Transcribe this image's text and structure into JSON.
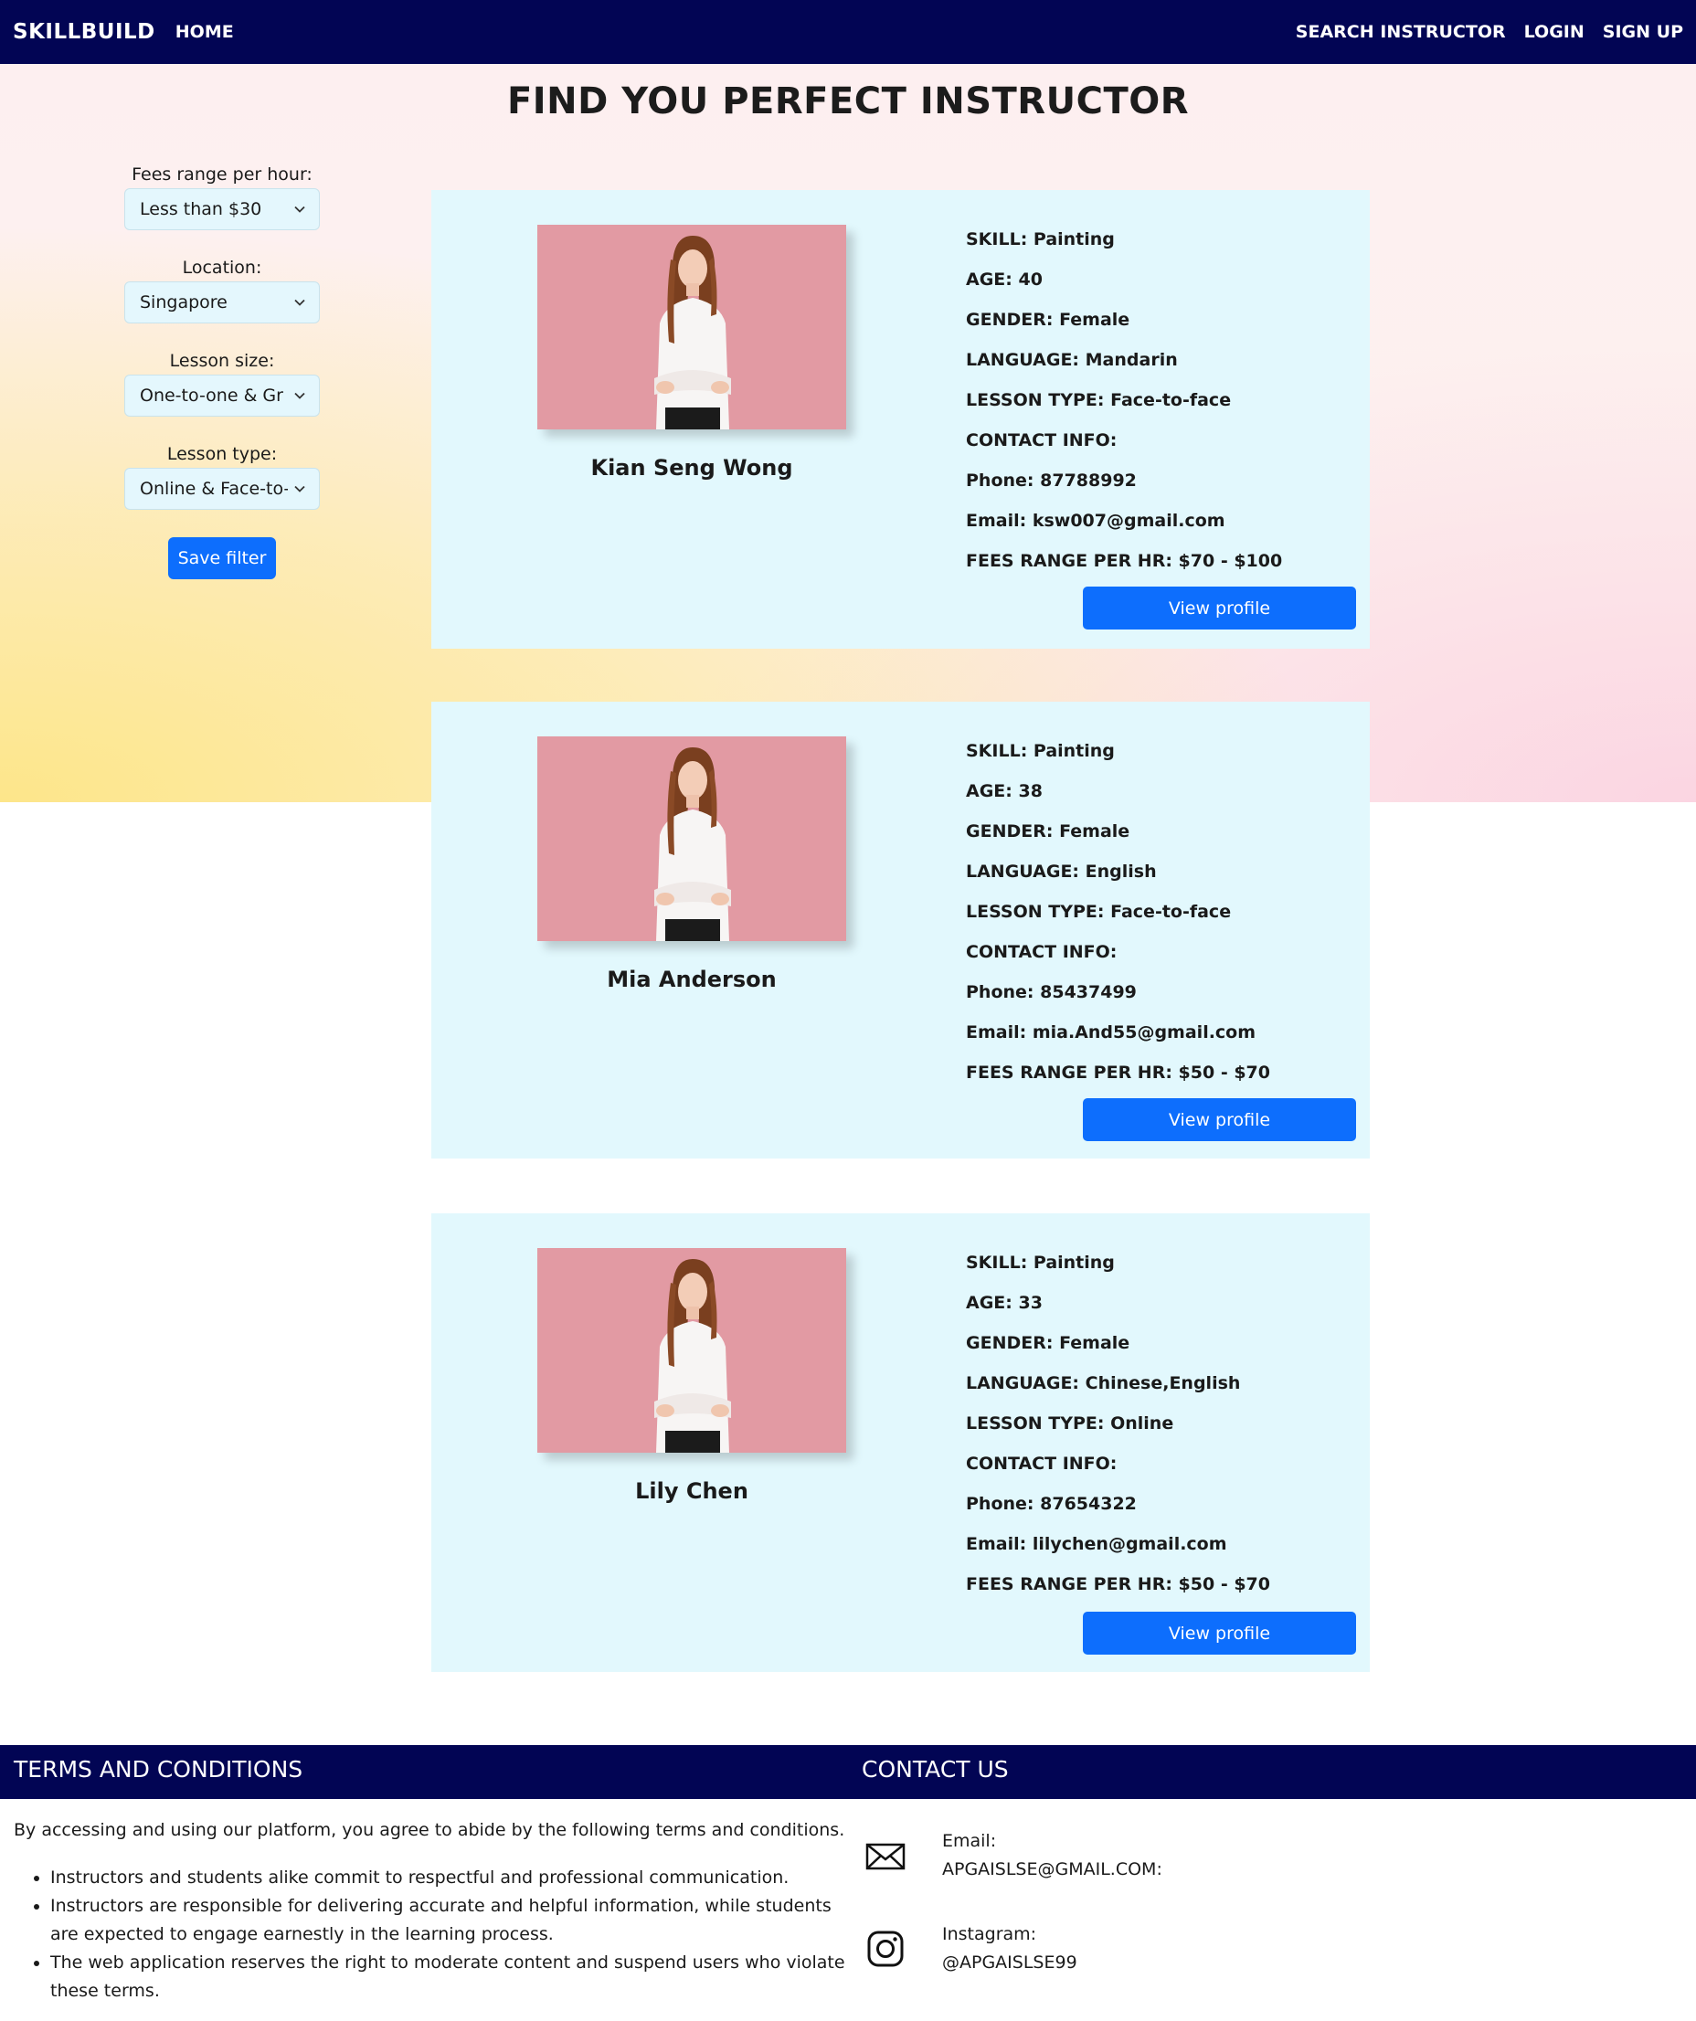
{
  "nav": {
    "brand": "SKILLBUILD",
    "home": "HOME",
    "search": "SEARCH INSTRUCTOR",
    "login": "LOGIN",
    "signup": "SIGN UP"
  },
  "page_title": "FIND YOU PERFECT INSTRUCTOR",
  "filters": {
    "fees_label": "Fees range per hour:",
    "fees_value": "Less than $30",
    "location_label": "Location:",
    "location_value": "Singapore",
    "size_label": "Lesson size:",
    "size_value": "One-to-one & Gr",
    "type_label": "Lesson type:",
    "type_value": "Online & Face-to-",
    "save_label": "Save filter"
  },
  "instructors": [
    {
      "name": "Kian Seng Wong",
      "skill": "SKILL: Painting",
      "age": "AGE: 40",
      "gender": "GENDER: Female",
      "language": "LANGUAGE: Mandarin",
      "lesson_type": "LESSON TYPE: Face-to-face",
      "contact": "CONTACT INFO:",
      "phone": "Phone: 87788992",
      "email": "Email: ksw007@gmail.com",
      "fees": "FEES RANGE PER HR: $70 - $100",
      "button": "View profile"
    },
    {
      "name": "Mia Anderson",
      "skill": "SKILL: Painting",
      "age": "AGE: 38",
      "gender": "GENDER: Female",
      "language": "LANGUAGE: English",
      "lesson_type": "LESSON TYPE: Face-to-face",
      "contact": "CONTACT INFO:",
      "phone": "Phone: 85437499",
      "email": "Email: mia.And55@gmail.com",
      "fees": "FEES RANGE PER HR: $50 - $70",
      "button": "View profile"
    },
    {
      "name": "Lily Chen",
      "skill": "SKILL: Painting",
      "age": "AGE: 33",
      "gender": "GENDER: Female",
      "language": "LANGUAGE: Chinese,English",
      "lesson_type": "LESSON TYPE: Online",
      "contact": "CONTACT INFO:",
      "phone": "Phone: 87654322",
      "email": "Email: lilychen@gmail.com",
      "fees": "FEES RANGE PER HR: $50 - $70",
      "button": "View profile"
    }
  ],
  "footer": {
    "terms_heading": "TERMS AND CONDITIONS",
    "contact_heading": "CONTACT US",
    "terms_intro": "By accessing and using our platform, you agree to abide by the following terms and conditions.",
    "terms": [
      "Instructors and students alike commit to respectful and professional communication.",
      "Instructors are responsible for delivering accurate and helpful information, while students are expected to engage earnestly in the learning process.",
      "The web application reserves the right to moderate content and suspend users who violate these terms."
    ],
    "email_label": "Email:",
    "email_value": "APGAISLSE@GMAIL.COM:",
    "instagram_label": "Instagram:",
    "instagram_value": "@APGAISLSE99"
  },
  "colors": {
    "navbar": "#020554",
    "button": "#0d6efd",
    "card_bg": "#e2f8fd"
  },
  "icons": [
    "chevron-down-icon",
    "envelope-icon",
    "instagram-icon"
  ]
}
